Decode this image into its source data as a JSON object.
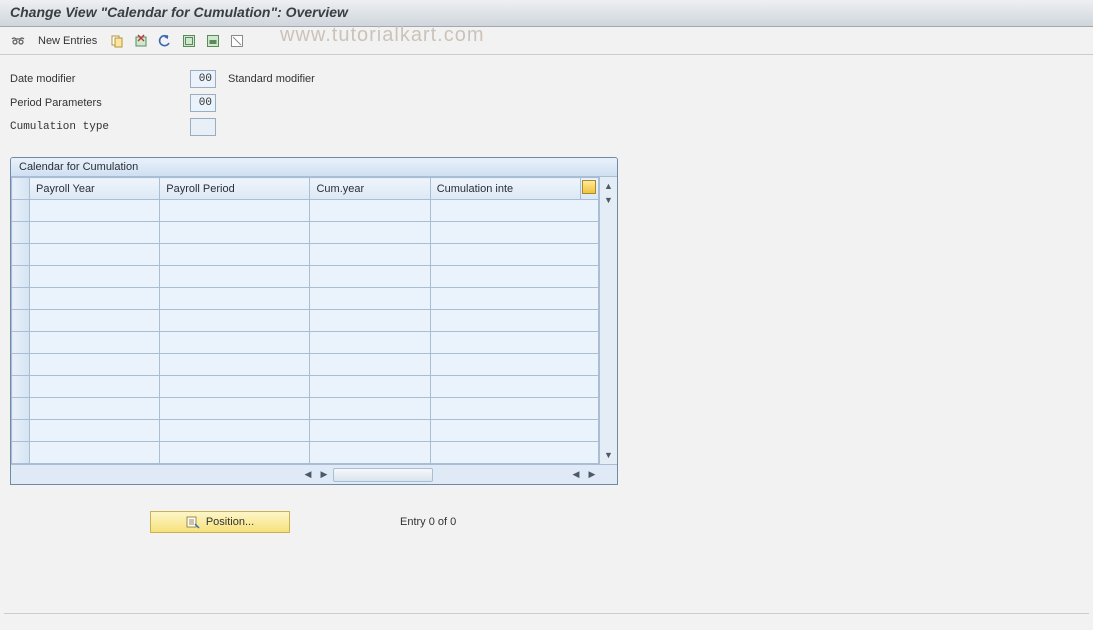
{
  "header": {
    "title": "Change View \"Calendar for Cumulation\": Overview"
  },
  "toolbar": {
    "new_entries": "New Entries"
  },
  "watermark": "www.tutorialkart.com",
  "form": {
    "date_modifier": {
      "label": "Date modifier",
      "value": "00",
      "desc": "Standard modifier"
    },
    "period_parameters": {
      "label": "Period Parameters",
      "value": "00"
    },
    "cumulation_type": {
      "label": "Cumulation type",
      "value": ""
    }
  },
  "table": {
    "title": "Calendar for Cumulation",
    "columns": [
      "Payroll Year",
      "Payroll Period",
      "Cum.year",
      "Cumulation inte"
    ]
  },
  "footer": {
    "position_label": "Position...",
    "entry_text": "Entry 0 of 0"
  }
}
